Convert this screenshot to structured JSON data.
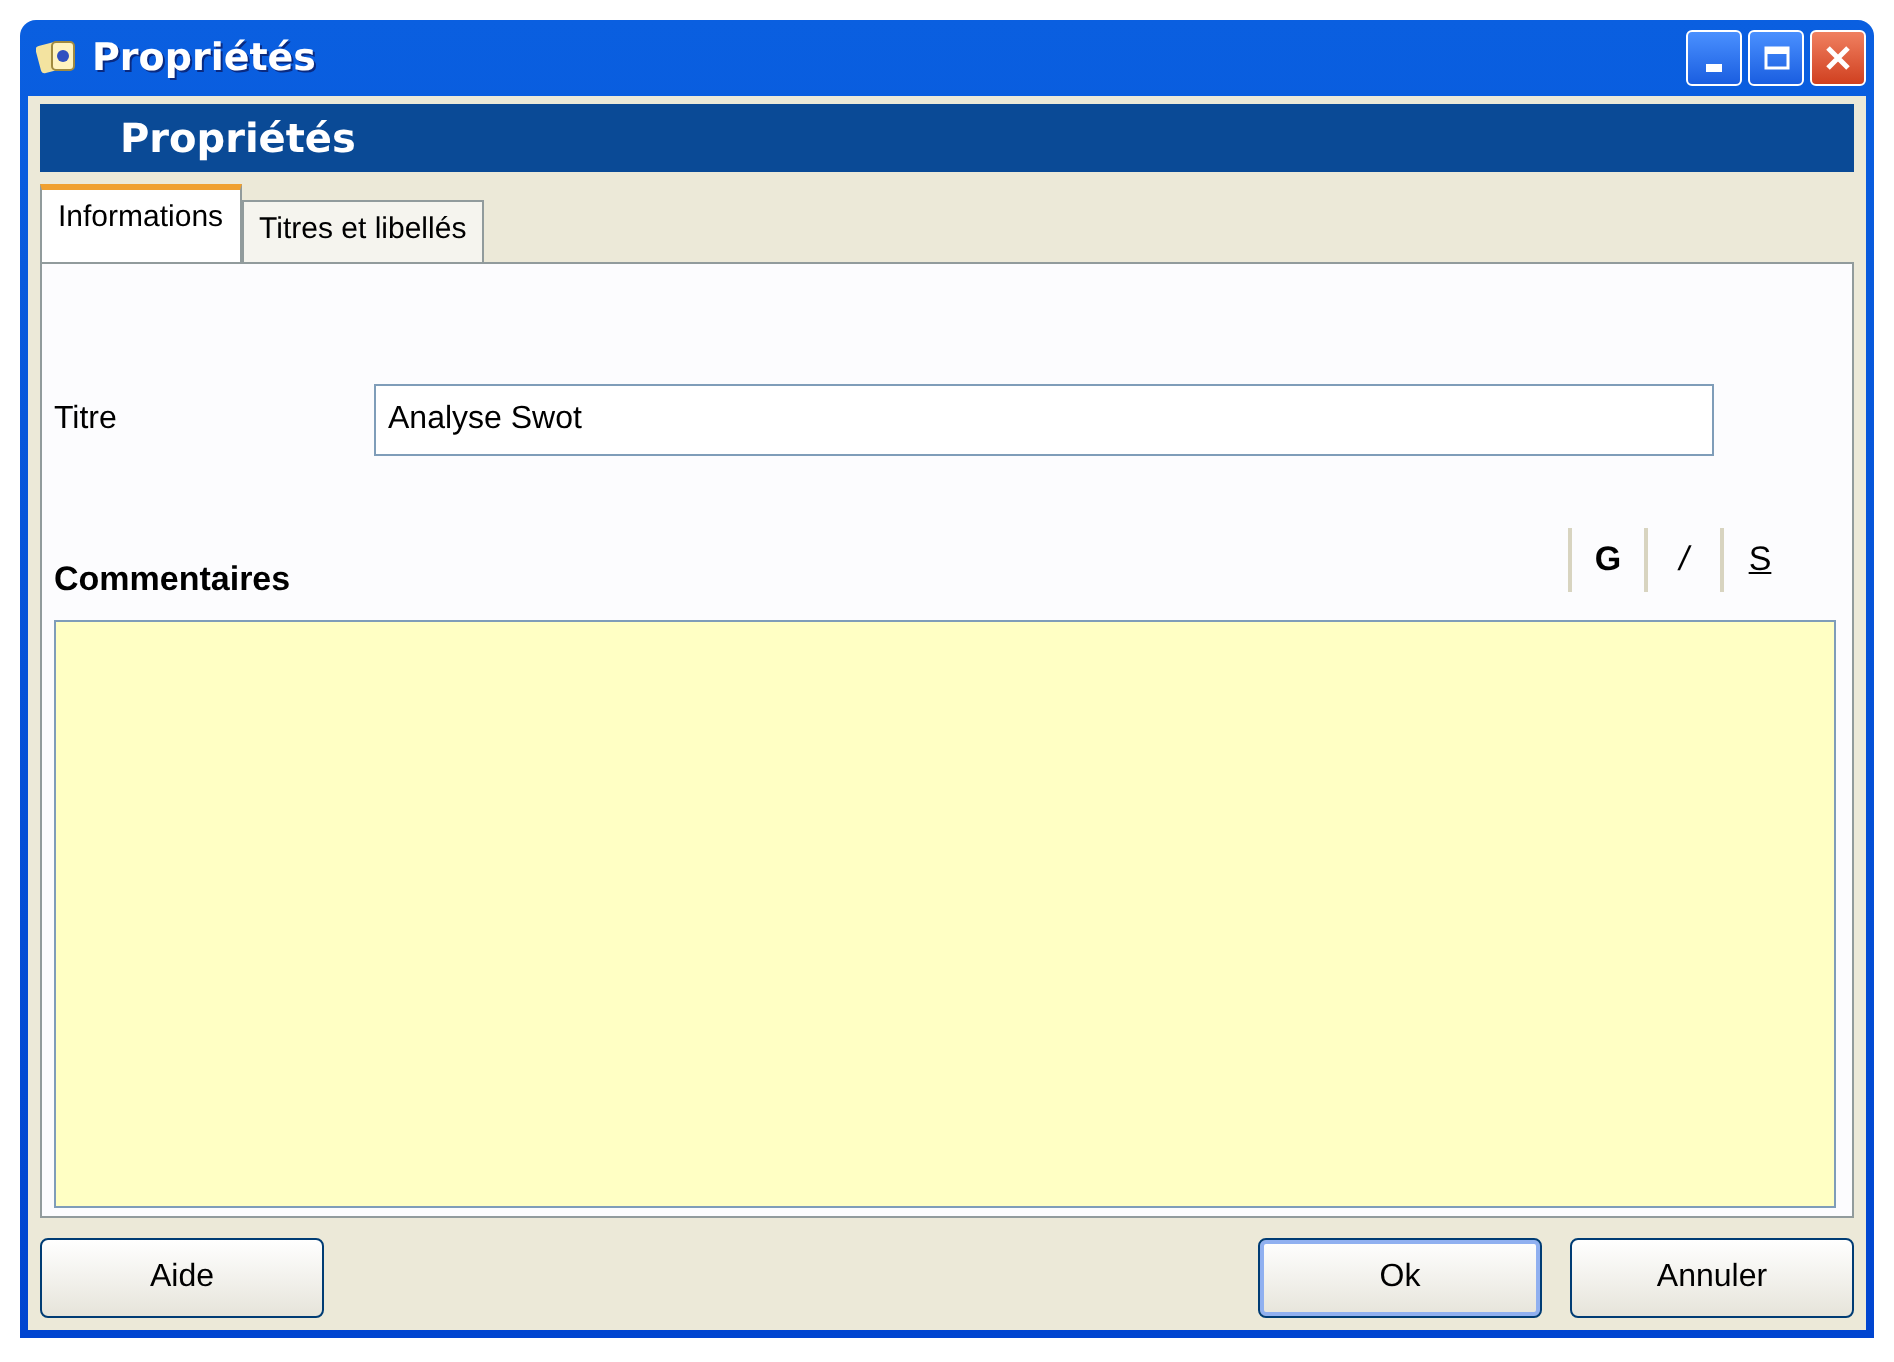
{
  "window": {
    "title": "Propriétés"
  },
  "header": {
    "title": "Propriétés"
  },
  "tabs": [
    {
      "label": "Informations",
      "selected": true
    },
    {
      "label": "Titres et libellés",
      "selected": false
    }
  ],
  "title_field": {
    "label": "Titre",
    "value": "Analyse Swot"
  },
  "comments": {
    "label": "Commentaires",
    "format_buttons": [
      {
        "label": "G",
        "kind": "bold"
      },
      {
        "label": "/",
        "kind": "italic"
      },
      {
        "label": "S",
        "kind": "underline"
      }
    ]
  },
  "buttons": {
    "left": [
      "Aide"
    ],
    "right": [
      {
        "label": "Ok",
        "default": true
      },
      {
        "label": "Annuler",
        "default": false
      }
    ]
  }
}
